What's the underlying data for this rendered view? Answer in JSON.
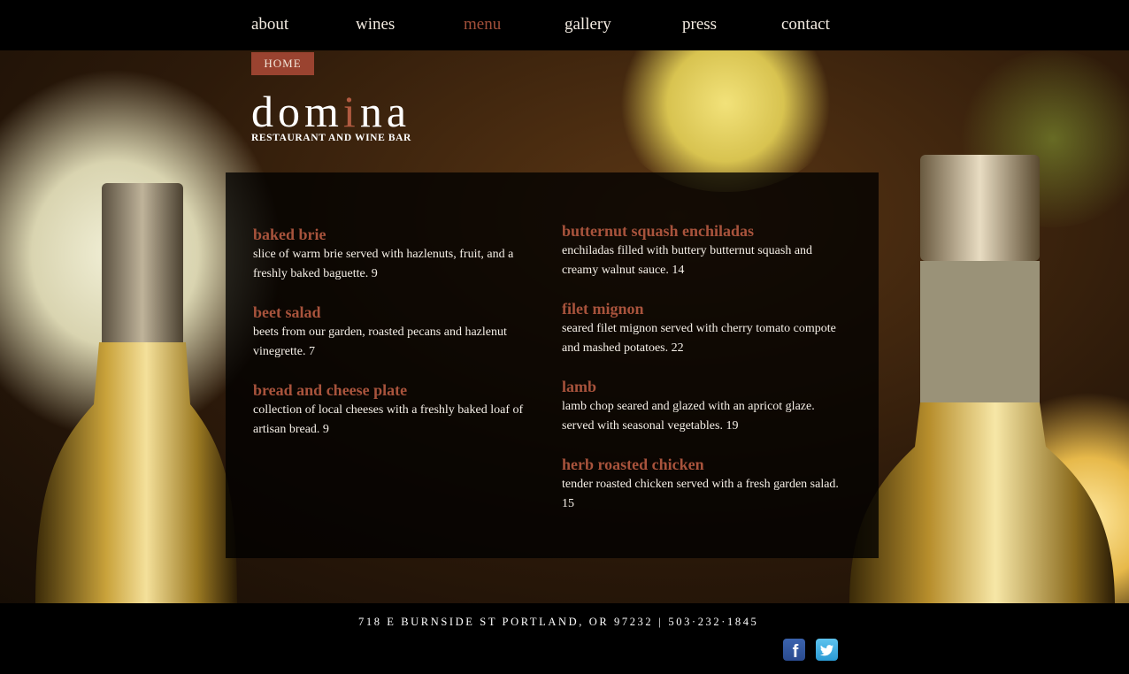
{
  "nav": {
    "items": [
      {
        "label": "about",
        "active": false
      },
      {
        "label": "wines",
        "active": false
      },
      {
        "label": "menu",
        "active": true
      },
      {
        "label": "gallery",
        "active": false
      },
      {
        "label": "press",
        "active": false
      },
      {
        "label": "contact",
        "active": false
      }
    ],
    "active_color": "#a3503a"
  },
  "header": {
    "home_button": "HOME",
    "logo_prefix": "dom",
    "logo_accent": "i",
    "logo_suffix": "na",
    "logo_tagline": "RESTAURANT AND WINE BAR"
  },
  "menu": {
    "left_column": [
      {
        "name": "baked brie",
        "description": "slice of warm brie served with hazlenuts, fruit, and a freshly baked baguette. 9"
      },
      {
        "name": "beet salad",
        "description": "beets from our garden, roasted pecans and hazlenut vinegrette. 7"
      },
      {
        "name": "bread and cheese plate",
        "description": "collection of local cheeses with a freshly baked loaf of artisan bread. 9"
      }
    ],
    "right_column": [
      {
        "name": "butternut squash enchiladas",
        "description": "enchiladas filled with buttery butternut squash and creamy walnut sauce. 14"
      },
      {
        "name": "filet mignon",
        "description": "seared filet mignon served with cherry tomato compote and mashed potatoes. 22"
      },
      {
        "name": "lamb",
        "description": "lamb chop seared and glazed with an apricot glaze. served with seasonal vegetables. 19"
      },
      {
        "name": "herb roasted chicken",
        "description": "tender roasted chicken served with a fresh garden salad. 15"
      }
    ],
    "name_color": "#a8533c"
  },
  "footer": {
    "address": "718 E BURNSIDE ST PORTLAND, OR  97232",
    "separator": "|",
    "phone": "503·232·1845",
    "social": [
      {
        "icon": "facebook-icon",
        "glyph": "f"
      },
      {
        "icon": "twitter-icon",
        "glyph": "t"
      }
    ]
  }
}
